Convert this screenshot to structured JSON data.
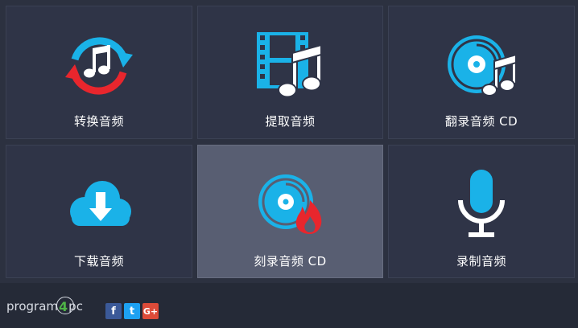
{
  "tiles": [
    {
      "label": "转换音频",
      "icon": "convert-audio-icon"
    },
    {
      "label": "提取音频",
      "icon": "extract-audio-icon"
    },
    {
      "label": "翻录音频 CD",
      "icon": "rip-cd-icon"
    },
    {
      "label": "下载音频",
      "icon": "download-audio-icon"
    },
    {
      "label": "刻录音频 CD",
      "icon": "burn-cd-icon"
    },
    {
      "label": "录制音频",
      "icon": "record-audio-icon"
    }
  ],
  "footer": {
    "brand_prefix": "program",
    "brand_digit": "4",
    "brand_suffix": "pc",
    "social": [
      {
        "label": "f",
        "color": "#3b5998",
        "icon": "facebook-icon"
      },
      {
        "label": "t",
        "color": "#1da1f2",
        "icon": "twitter-icon"
      },
      {
        "label": "G+",
        "color": "#dd4b39",
        "icon": "google-plus-icon"
      }
    ]
  },
  "colors": {
    "accent_blue": "#1ab2e8",
    "accent_red": "#e8262d",
    "tile_bg": "#2f3447",
    "tile_active_bg": "#585e72"
  }
}
